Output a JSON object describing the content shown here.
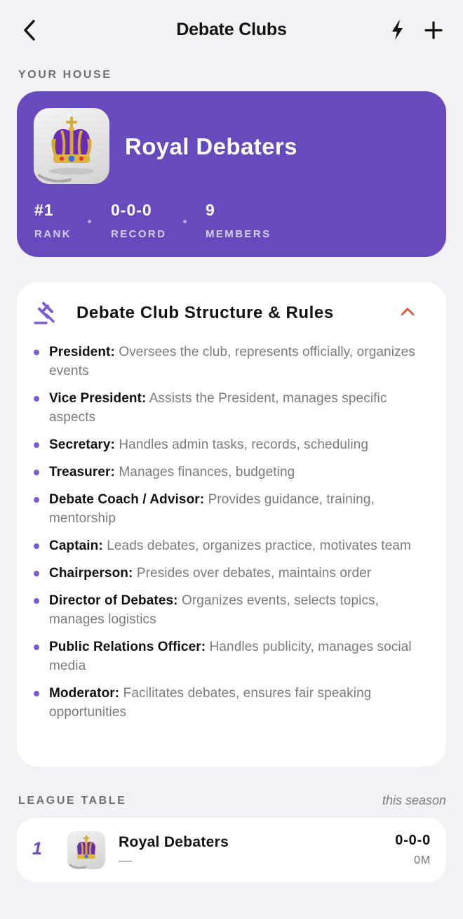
{
  "header": {
    "title": "Debate Clubs",
    "back_icon": "chevron-left-icon",
    "bolt_icon": "lightning-bolt-icon",
    "add_icon": "plus-icon"
  },
  "house": {
    "section_label": "YOUR HOUSE",
    "name": "Royal Debaters",
    "emblem_icon": "crown-icon",
    "accent_color": "#674bbd",
    "stats": [
      {
        "value": "#1",
        "label": "RANK"
      },
      {
        "value": "0-0-0",
        "label": "RECORD"
      },
      {
        "value": "9",
        "label": "MEMBERS"
      }
    ]
  },
  "rules": {
    "icon": "gavel-icon",
    "title": "Debate Club Structure & Rules",
    "toggle_icon": "chevron-up-icon",
    "items": [
      {
        "role": "President:",
        "desc": "Oversees the club, represents officially, organizes events"
      },
      {
        "role": "Vice President:",
        "desc": "Assists the President, manages specific aspects"
      },
      {
        "role": "Secretary:",
        "desc": "Handles admin tasks, records, scheduling"
      },
      {
        "role": "Treasurer:",
        "desc": "Manages finances, budgeting"
      },
      {
        "role": "Debate Coach / Advisor:",
        "desc": "Provides guidance, training, mentorship"
      },
      {
        "role": "Captain:",
        "desc": "Leads debates, organizes practice, motivates team"
      },
      {
        "role": "Chairperson:",
        "desc": "Presides over debates, maintains order"
      },
      {
        "role": "Director of Debates:",
        "desc": "Organizes events, selects topics, manages logistics"
      },
      {
        "role": "Public Relations Officer:",
        "desc": "Handles publicity, manages social media"
      },
      {
        "role": "Moderator:",
        "desc": "Facilitates debates, ensures fair speaking opportunities"
      }
    ]
  },
  "league": {
    "section_label": "LEAGUE TABLE",
    "hint": "this season",
    "rows": [
      {
        "rank": "1",
        "name": "Royal Debaters",
        "sub": "—",
        "record": "0-0-0",
        "points": "0M"
      }
    ]
  }
}
